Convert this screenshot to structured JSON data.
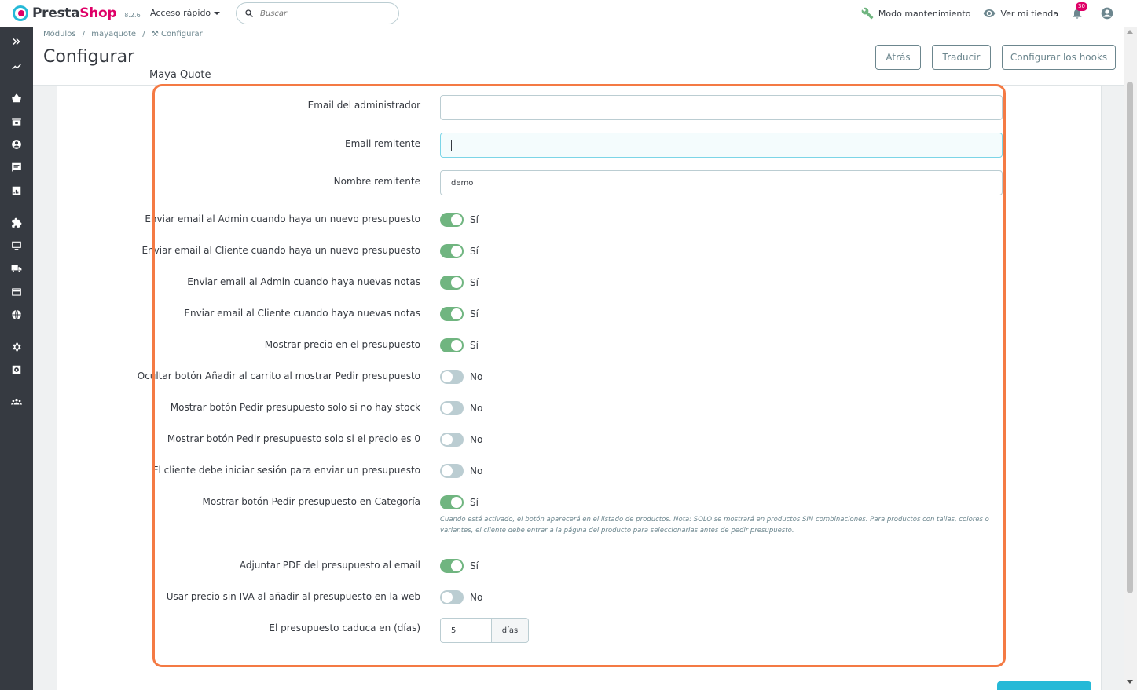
{
  "app": {
    "logo_text_presta": "Presta",
    "logo_text_shop": "Shop",
    "version": "8.2.6",
    "quick_access": "Acceso rápido",
    "search_placeholder": "Buscar",
    "maintenance": "Modo mantenimiento",
    "view_store": "Ver mi tienda",
    "notification_count": "30"
  },
  "breadcrumb": {
    "item1": "Módulos",
    "item2": "mayaquote",
    "item3": "Configurar",
    "sep": "/"
  },
  "header": {
    "title": "Configurar",
    "subtitle": "Maya Quote",
    "btn_back": "Atrás",
    "btn_translate": "Traducir",
    "btn_hooks": "Configurar los hooks"
  },
  "sidebar": {
    "icons": [
      "expand-icon",
      "dashboard-icon",
      "orders-icon",
      "catalog-icon",
      "customers-icon",
      "messages-icon",
      "stats-icon",
      "modules-icon",
      "design-icon",
      "shipping-icon",
      "payment-icon",
      "international-icon",
      "settings-icon",
      "advanced-icon",
      "team-icon"
    ]
  },
  "form": {
    "admin_email_label": "Email del administrador",
    "admin_email_value": "",
    "sender_email_label": "Email remitente",
    "sender_email_value": "",
    "sender_name_label": "Nombre remitente",
    "sender_name_value": "demo",
    "toggles": [
      {
        "label": "Enviar email al Admin cuando haya un nuevo presupuesto",
        "state": "on",
        "text": "Sí"
      },
      {
        "label": "Enviar email al Cliente cuando haya un nuevo presupuesto",
        "state": "on",
        "text": "Sí"
      },
      {
        "label": "Enviar email al Admin cuando haya nuevas notas",
        "state": "on",
        "text": "Sí"
      },
      {
        "label": "Enviar email al Cliente cuando haya nuevas notas",
        "state": "on",
        "text": "Sí"
      },
      {
        "label": "Mostrar precio en el presupuesto",
        "state": "on",
        "text": "Sí"
      },
      {
        "label": "Ocultar botón Añadir al carrito al mostrar Pedir presupuesto",
        "state": "off",
        "text": "No"
      },
      {
        "label": "Mostrar botón Pedir presupuesto solo si no hay stock",
        "state": "off",
        "text": "No"
      },
      {
        "label": "Mostrar botón Pedir presupuesto solo si el precio es 0",
        "state": "off",
        "text": "No"
      },
      {
        "label": "El cliente debe iniciar sesión para enviar un presupuesto",
        "state": "off",
        "text": "No"
      },
      {
        "label": "Mostrar botón Pedir presupuesto en Categoría",
        "state": "on",
        "text": "Sí"
      },
      {
        "label": "Adjuntar PDF del presupuesto al email",
        "state": "on",
        "text": "Sí"
      },
      {
        "label": "Usar precio sin IVA al añadir al presupuesto en la web",
        "state": "off",
        "text": "No"
      }
    ],
    "category_help": "Cuando está activado, el botón aparecerá en el listado de productos. Nota: SOLO se mostrará en productos SIN combinaciones. Para productos con tallas, colores o variantes, el cliente debe entrar a la página del producto para seleccionarlas antes de pedir presupuesto.",
    "expiry_label": "El presupuesto caduca en (días)",
    "expiry_value": "5",
    "expiry_unit": "días"
  },
  "colors": {
    "accent": "#25b9d7",
    "brand": "#df0067",
    "switch_on": "#70b580",
    "switch_off": "#bbcdd2",
    "highlight": "#f47a44"
  }
}
